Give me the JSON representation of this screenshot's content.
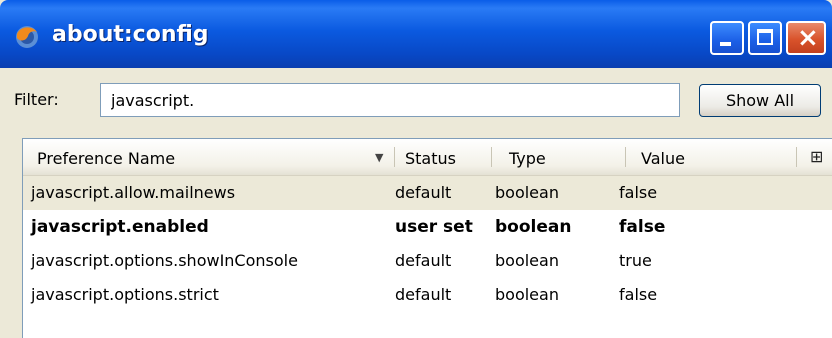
{
  "window": {
    "title": "about:config"
  },
  "filter": {
    "label": "Filter:",
    "value": "javascript."
  },
  "show_all_label": "Show All",
  "columns": [
    "Preference Name",
    "Status",
    "Type",
    "Value"
  ],
  "rows": [
    {
      "name": "javascript.allow.mailnews",
      "status": "default",
      "type": "boolean",
      "value": "false",
      "user_set": false,
      "selected": true
    },
    {
      "name": "javascript.enabled",
      "status": "user set",
      "type": "boolean",
      "value": "false",
      "user_set": true,
      "selected": false
    },
    {
      "name": "javascript.options.showInConsole",
      "status": "default",
      "type": "boolean",
      "value": "true",
      "user_set": false,
      "selected": false
    },
    {
      "name": "javascript.options.strict",
      "status": "default",
      "type": "boolean",
      "value": "false",
      "user_set": false,
      "selected": false
    }
  ],
  "icons": {
    "app": "firefox-logo-icon",
    "sort": "sort-descending-icon",
    "column_picker": "column-picker-icon"
  }
}
